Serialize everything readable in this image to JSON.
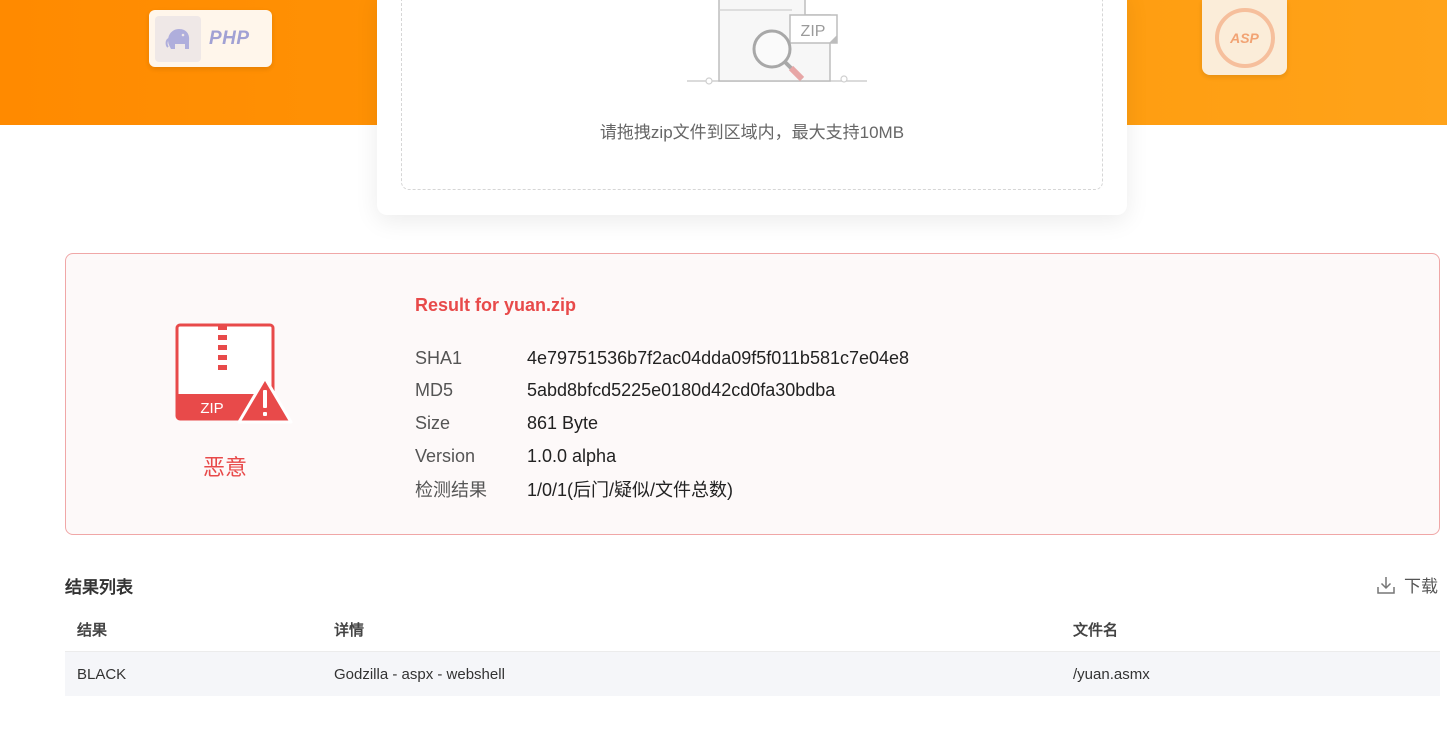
{
  "banner": {
    "left_badge": {
      "label": "PHP",
      "icon": "elephant-icon"
    },
    "right_badge": {
      "label": "ASP",
      "icon": "asp-logo-icon"
    }
  },
  "upload": {
    "illustration_label": "ZIP",
    "hint": "请拖拽zip文件到区域内，最大支持10MB"
  },
  "result": {
    "title": "Result for yuan.zip",
    "verdict": "恶意",
    "verdict_icon": "zip-warning-icon",
    "verdict_icon_label": "ZIP",
    "accent_color": "#e84a4a",
    "fields": [
      {
        "key": "SHA1",
        "value": "4e79751536b7f2ac04dda09f5f011b581c7e04e8"
      },
      {
        "key": "MD5",
        "value": "5abd8bfcd5225e0180d42cd0fa30bdba"
      },
      {
        "key": "Size",
        "value": "861 Byte"
      },
      {
        "key": "Version",
        "value": "1.0.0 alpha"
      },
      {
        "key": "检测结果",
        "value": "1/0/1(后门/疑似/文件总数)"
      }
    ]
  },
  "results_list": {
    "title": "结果列表",
    "download_label": "下载",
    "columns": [
      "结果",
      "详情",
      "文件名"
    ],
    "rows": [
      [
        "BLACK",
        "Godzilla - aspx - webshell",
        "/yuan.asmx"
      ]
    ]
  }
}
